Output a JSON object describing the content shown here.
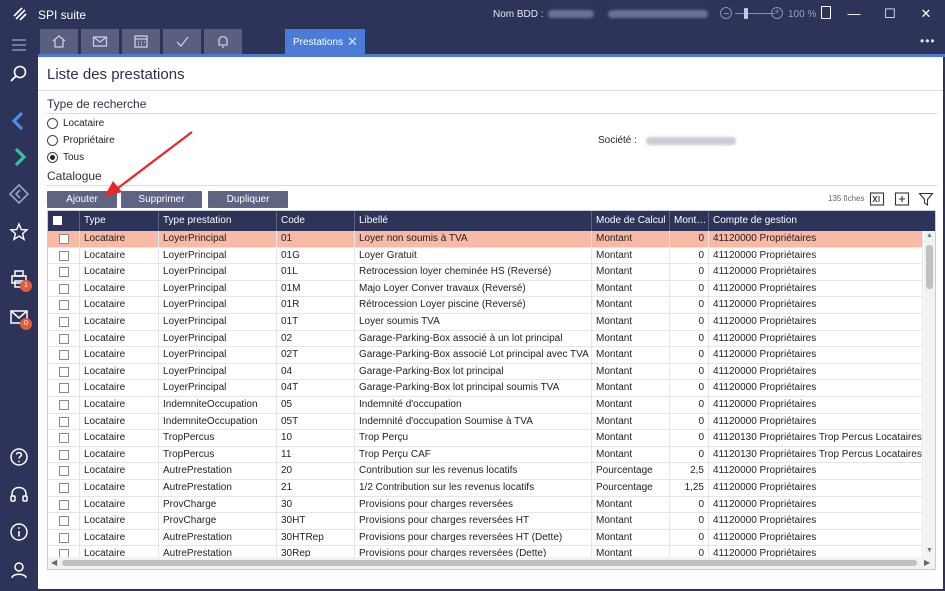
{
  "app": {
    "title": "SPI suite",
    "db_label": "Nom BDD :",
    "zoom": "100 %"
  },
  "tabs": {
    "active_label": "Prestations",
    "icons": [
      "home-icon",
      "mail-icon",
      "calendar-icon",
      "check-icon",
      "bell-icon"
    ]
  },
  "rail": {
    "badge_print": "1",
    "badge_mail": "0"
  },
  "page": {
    "title": "Liste des prestations"
  },
  "search": {
    "title": "Type de recherche",
    "options": [
      "Locataire",
      "Propriétaire",
      "Tous"
    ],
    "selected": "Tous",
    "societe_label": "Société :"
  },
  "catalogue": {
    "title": "Catalogue",
    "buttons": {
      "add": "Ajouter",
      "delete": "Supprimer",
      "duplicate": "Dupliquer"
    },
    "count": "135 fiches"
  },
  "grid": {
    "columns": [
      "Type",
      "Type prestation",
      "Code",
      "Libellé",
      "Mode de Calcul",
      "Mont…",
      "Compte de gestion"
    ],
    "rows": [
      [
        "Locataire",
        "LoyerPrincipal",
        "01",
        "Loyer non soumis à TVA",
        "Montant",
        "0",
        "41120000 Propriétaires"
      ],
      [
        "Locataire",
        "LoyerPrincipal",
        "01G",
        "Loyer Gratuit",
        "Montant",
        "0",
        "41120000 Propriétaires"
      ],
      [
        "Locataire",
        "LoyerPrincipal",
        "01L",
        "Retrocession loyer cheminée HS (Reversé)",
        "Montant",
        "0",
        "41120000 Propriétaires"
      ],
      [
        "Locataire",
        "LoyerPrincipal",
        "01M",
        "Majo Loyer Conver travaux (Reversé)",
        "Montant",
        "0",
        "41120000 Propriétaires"
      ],
      [
        "Locataire",
        "LoyerPrincipal",
        "01R",
        "Rétrocession Loyer piscine (Reversé)",
        "Montant",
        "0",
        "41120000 Propriétaires"
      ],
      [
        "Locataire",
        "LoyerPrincipal",
        "01T",
        "Loyer soumis TVA",
        "Montant",
        "0",
        "41120000 Propriétaires"
      ],
      [
        "Locataire",
        "LoyerPrincipal",
        "02",
        "Garage-Parking-Box associé à un lot principal",
        "Montant",
        "0",
        "41120000 Propriétaires"
      ],
      [
        "Locataire",
        "LoyerPrincipal",
        "02T",
        "Garage-Parking-Box associé Lot principal avec TVA",
        "Montant",
        "0",
        "41120000 Propriétaires"
      ],
      [
        "Locataire",
        "LoyerPrincipal",
        "04",
        "Garage-Parking-Box lot principal",
        "Montant",
        "0",
        "41120000 Propriétaires"
      ],
      [
        "Locataire",
        "LoyerPrincipal",
        "04T",
        "Garage-Parking-Box lot principal soumis TVA",
        "Montant",
        "0",
        "41120000 Propriétaires"
      ],
      [
        "Locataire",
        "IndemniteOccupation",
        "05",
        "Indemnité d'occupation",
        "Montant",
        "0",
        "41120000 Propriétaires"
      ],
      [
        "Locataire",
        "IndemniteOccupation",
        "05T",
        "Indemnité d'occupation Soumise à TVA",
        "Montant",
        "0",
        "41120000 Propriétaires"
      ],
      [
        "Locataire",
        "TropPercus",
        "10",
        "Trop Perçu",
        "Montant",
        "0",
        "41120130 Propriétaires Trop Percus Locataires"
      ],
      [
        "Locataire",
        "TropPercus",
        "11",
        "Trop Perçu CAF",
        "Montant",
        "0",
        "41120130 Propriétaires Trop Percus Locataires"
      ],
      [
        "Locataire",
        "AutrePrestation",
        "20",
        "Contribution sur les revenus locatifs",
        "Pourcentage",
        "2,5",
        "41120000 Propriétaires"
      ],
      [
        "Locataire",
        "AutrePrestation",
        "21",
        "1/2 Contribution sur les revenus locatifs",
        "Pourcentage",
        "1,25",
        "41120000 Propriétaires"
      ],
      [
        "Locataire",
        "ProvCharge",
        "30",
        "Provisions pour charges reversées",
        "Montant",
        "0",
        "41120000 Propriétaires"
      ],
      [
        "Locataire",
        "ProvCharge",
        "30HT",
        "Provisions pour charges reversées HT",
        "Montant",
        "0",
        "41120000 Propriétaires"
      ],
      [
        "Locataire",
        "AutrePrestation",
        "30HTRep",
        "Provisions pour charges reversées HT (Dette)",
        "Montant",
        "0",
        "41120000 Propriétaires"
      ],
      [
        "Locataire",
        "AutrePrestation",
        "30Rep",
        "Provisions pour charges reversées (Dette)",
        "Montant",
        "0",
        "41120000 Propriétaires"
      ]
    ],
    "selected_row": 0
  },
  "colors": {
    "sidebar": "#2d3359",
    "accent": "#4a7bd6",
    "selected_row": "#f8b9a5",
    "button": "#5f6482",
    "annotation": "#e8262a"
  }
}
